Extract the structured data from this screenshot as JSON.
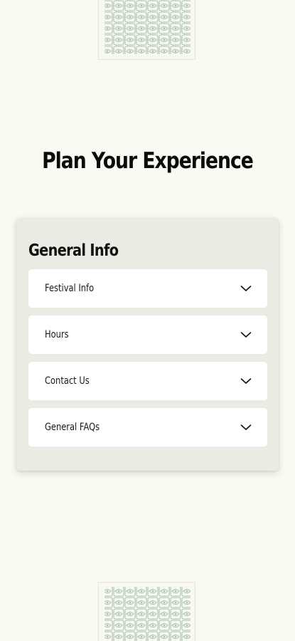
{
  "page": {
    "title": "Plan Your Experience"
  },
  "general_info": {
    "heading": "General Info",
    "items": [
      {
        "label": "Festival Info",
        "icon": "chevron-down-icon"
      },
      {
        "label": "Hours",
        "icon": "chevron-down-icon"
      },
      {
        "label": "Contact Us",
        "icon": "chevron-down-icon"
      },
      {
        "label": "General FAQs",
        "icon": "chevron-down-icon"
      }
    ]
  },
  "decoration": {
    "pattern_color": "#9fb8a6",
    "background": "#fafaf2",
    "panel_color": "#ecebe3"
  }
}
